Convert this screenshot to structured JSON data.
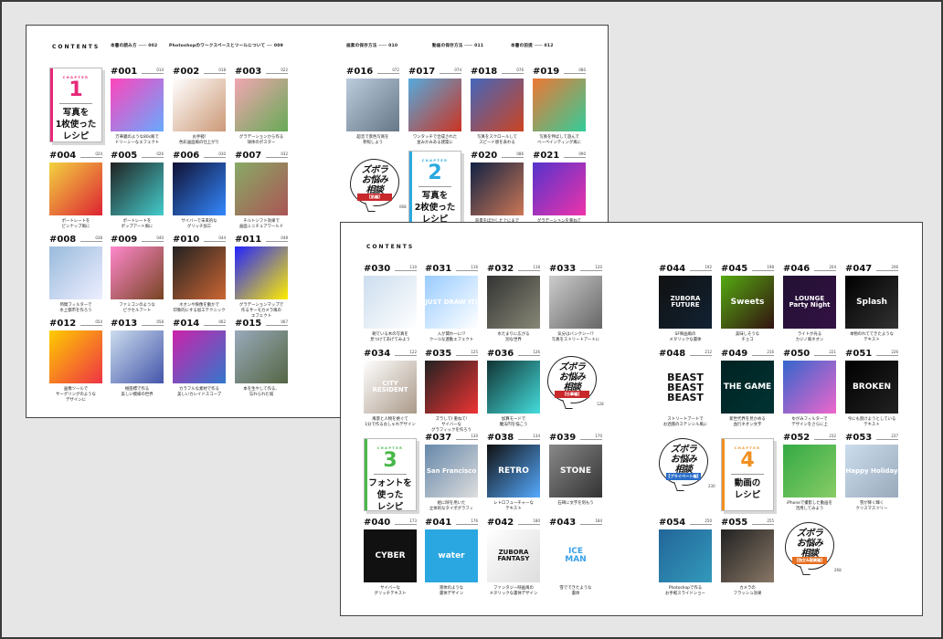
{
  "spread_a": {
    "contents_label": "CONTENTS",
    "headers": [
      {
        "text": "本書の読み方",
        "page": "002"
      },
      {
        "text": "Photoshopのワークスペースとツールについて",
        "page": "009"
      },
      {
        "text": "画素の保存方法",
        "page": "010"
      },
      {
        "text": "動画の保存方法",
        "page": "011"
      },
      {
        "text": "本書の前提",
        "page": "012"
      }
    ],
    "chapter1": {
      "label": "CHAPTER",
      "number": "1",
      "title": "写真を\n1枚使った\nレシピ"
    },
    "chapter2": {
      "label": "CHAPTER",
      "number": "2",
      "title": "写真を\n2枚使った\nレシピ"
    },
    "bubble": {
      "text": "ズボラ\nお悩み\n相談",
      "tag": "【肌編】",
      "page": "068"
    },
    "items": [
      {
        "num": "#001",
        "page": "014",
        "caption": "万華鏡のような80s風で\nドリーミーなエフェクト",
        "colors": [
          "#f4b",
          "#6af"
        ]
      },
      {
        "num": "#002",
        "page": "018",
        "caption": "お手軽!\n色彩画面風の仕上がり",
        "colors": [
          "#fff",
          "#c97"
        ]
      },
      {
        "num": "#003",
        "page": "022",
        "caption": "グラデーションから作る\n球体のポスター",
        "colors": [
          "#f2a6b2",
          "#6a5"
        ]
      },
      {
        "num": "#004",
        "page": "024",
        "caption": "ポートレートを\nピンナップ風に",
        "colors": [
          "#f3d33f",
          "#d23"
        ]
      },
      {
        "num": "#005",
        "page": "026",
        "caption": "ポートレートを\nポップアート風に",
        "colors": [
          "#222",
          "#4cc"
        ]
      },
      {
        "num": "#006",
        "page": "030",
        "caption": "サイバーで未来的な\nグリッチ加工",
        "colors": [
          "#113",
          "#38f"
        ]
      },
      {
        "num": "#007",
        "page": "032",
        "caption": "チルトシフト効果で\n画面ミニチュアワールド",
        "colors": [
          "#8a6",
          "#a55"
        ]
      },
      {
        "num": "#008",
        "page": "038",
        "caption": "時間フィルターで\n水上都市を作ろう",
        "colors": [
          "#9bd",
          "#eef"
        ]
      },
      {
        "num": "#009",
        "page": "040",
        "caption": "ファミコンのような\nピクセルアート",
        "colors": [
          "#f8c",
          "#742"
        ]
      },
      {
        "num": "#010",
        "page": "044",
        "caption": "ネオンや映像を動かで\n印象的にする加工テクニック",
        "colors": [
          "#222",
          "#c63"
        ]
      },
      {
        "num": "#011",
        "page": "048",
        "caption": "グラデーションマップで\n作るサーモカメラ風の\nエフェクト",
        "colors": [
          "#22f",
          "#fe0"
        ]
      },
      {
        "num": "#012",
        "page": "054",
        "caption": "画像ツールで\nサーグリングのような\nデザインに",
        "colors": [
          "#fc0",
          "#e34"
        ]
      },
      {
        "num": "#013",
        "page": "058",
        "caption": "極座標で作る\n美しい模様の世界",
        "colors": [
          "#cde",
          "#45a"
        ]
      },
      {
        "num": "#014",
        "page": "062",
        "caption": "カラフルな素材で作る\n美しいカレイドスコープ",
        "colors": [
          "#c2a",
          "#37c"
        ]
      },
      {
        "num": "#015",
        "page": "067",
        "caption": "本を生やして作る、\n忘れられた城",
        "colors": [
          "#9ab",
          "#564"
        ]
      },
      {
        "num": "#016",
        "page": "072",
        "caption": "超音で景色写真を\n参照しよう",
        "colors": [
          "#bcd",
          "#678"
        ]
      },
      {
        "num": "#017",
        "page": "074",
        "caption": "ワンタッチで合成された\n並みかみある建築に",
        "colors": [
          "#5ad",
          "#c32"
        ]
      },
      {
        "num": "#018",
        "page": "076",
        "caption": "写真をスクロールして\nスピード感を表わる",
        "colors": [
          "#46b",
          "#c42"
        ]
      },
      {
        "num": "#019",
        "page": "080",
        "caption": "写真を伸ばして遊んで\nベーペインティング風に",
        "colors": [
          "#e73",
          "#3c9"
        ]
      },
      {
        "num": "#020",
        "page": "086",
        "caption": "背景をぼかした上にまで\nスピード感溢れる描出に",
        "colors": [
          "#124",
          "#c75"
        ]
      },
      {
        "num": "#021",
        "page": "090",
        "caption": "グラデーションを重ねて\n作品に奥行きを出す",
        "colors": [
          "#53c",
          "#e3a"
        ]
      }
    ]
  },
  "spread_b": {
    "contents_label": "CONTENTS",
    "chapter3": {
      "label": "CHAPTER",
      "number": "3",
      "title": "フォントを\n使った\nレシピ"
    },
    "chapter4": {
      "label": "CHAPTER",
      "number": "4",
      "title": "動画の\nレシピ"
    },
    "bubbles": [
      {
        "text": "ズボラ\nお悩み\n相談",
        "tag": "【仕事編】",
        "page": "128"
      },
      {
        "text": "ズボラ\nお悩み\n相談",
        "tag": "【プライベート編】",
        "page": "230"
      },
      {
        "text": "ズボラ\nお悩み\n相談",
        "tag": "【独立&副業編】",
        "page": "268"
      }
    ],
    "items": [
      {
        "num": "#030",
        "page": "110",
        "caption": "朝ている木の写真を\n見つけてあげてみよう",
        "colors": [
          "#cde",
          "#fff"
        ],
        "text": ""
      },
      {
        "num": "#031",
        "page": "116",
        "caption": "入が関わ一に!?\nクールな連動エフェクト",
        "colors": [
          "#9cf",
          "#fff"
        ],
        "text": "JUST DRAW IT!"
      },
      {
        "num": "#032",
        "page": "118",
        "caption": "水たまりに広がる\n別な世界",
        "colors": [
          "#333",
          "#887"
        ],
        "text": ""
      },
      {
        "num": "#033",
        "page": "120",
        "caption": "気分はバンクシー!?\n写真をストリートアートに",
        "colors": [
          "#ccc",
          "#666"
        ],
        "text": ""
      },
      {
        "num": "#034",
        "page": "122",
        "caption": "風景と人物を絶ぐて\n1分で作るおしゃれデザイン",
        "colors": [
          "#fff",
          "#a98"
        ],
        "text": "CITY RESIDENT"
      },
      {
        "num": "#035",
        "page": "125",
        "caption": "ズラしてI 重ねて!\nサイバーな\nグラフィックを作ろう",
        "colors": [
          "#222",
          "#e33"
        ],
        "text": ""
      },
      {
        "num": "#036",
        "page": "126",
        "caption": "加算モードで\n魔法円を描こう",
        "colors": [
          "#133",
          "#4dd"
        ],
        "text": ""
      },
      {
        "num": "#037",
        "page": "130",
        "caption": "絵に映を用いた\n立体的なタイポグラフィ",
        "colors": [
          "#68a",
          "#ddd"
        ],
        "text": "San Francisco"
      },
      {
        "num": "#038",
        "page": "134",
        "caption": "レトロフューチャーな\nテキスト",
        "colors": [
          "#111",
          "#5af"
        ],
        "text": "RETRO"
      },
      {
        "num": "#039",
        "page": "170",
        "caption": "石碑に文字を刻もう",
        "colors": [
          "#888",
          "#333"
        ],
        "text": "STONE"
      },
      {
        "num": "#040",
        "page": "173",
        "caption": "サイバーな\nグリッチテキスト",
        "colors": [
          "#111",
          "#111"
        ],
        "text": "CYBER"
      },
      {
        "num": "#041",
        "page": "176",
        "caption": "液体のような\n書体デザイン",
        "colors": [
          "#2aa7e0",
          "#2aa7e0"
        ],
        "text": "water"
      },
      {
        "num": "#042",
        "page": "180",
        "caption": "ファンタジー映画風の\nメタリックな書体デザイン",
        "colors": [
          "#fff",
          "#ddd"
        ],
        "text": "ZUBORA\nFANTASY"
      },
      {
        "num": "#043",
        "page": "184",
        "caption": "雪でできたような\n書体",
        "colors": [
          "#fff",
          "#fff"
        ],
        "text": "ICE\nMAN"
      },
      {
        "num": "#044",
        "page": "192",
        "caption": "SF映画風の\nメタリックな書体",
        "colors": [
          "#111",
          "#123"
        ],
        "text": "ZUBORA\nFUTURE"
      },
      {
        "num": "#045",
        "page": "198",
        "caption": "美味しそうな\nチョコ",
        "colors": [
          "#5a1",
          "#311"
        ],
        "text": "Sweets"
      },
      {
        "num": "#046",
        "page": "204",
        "caption": "ライトが光る\nカジノ風ネオン",
        "colors": [
          "#213",
          "#314"
        ],
        "text": "LOUNGE\nParty Night"
      },
      {
        "num": "#047",
        "page": "206",
        "caption": "本物のれててきたような\nテキスト",
        "colors": [
          "#000",
          "#333"
        ],
        "text": "Splash"
      },
      {
        "num": "#048",
        "page": "212",
        "caption": "ストリートアートで\nお洒落のステンシル風に",
        "colors": [
          "#fff",
          "#fff"
        ],
        "text": "BEAST\nBEAST\nBEAST"
      },
      {
        "num": "#049",
        "page": "216",
        "caption": "新世代界を見かめる\n血行ネオン文字",
        "colors": [
          "#022",
          "#033"
        ],
        "text": "THE GAME"
      },
      {
        "num": "#050",
        "page": "221",
        "caption": "ゆがみフィルターで\nデザインをさらに上",
        "colors": [
          "#36c",
          "#e6c"
        ],
        "text": ""
      },
      {
        "num": "#051",
        "page": "226",
        "caption": "今にも割けようとしている\nテキスト",
        "colors": [
          "#000",
          "#222"
        ],
        "text": "BROKEN"
      },
      {
        "num": "#052",
        "page": "232",
        "caption": "iPhoneで撮影した動画を\n活用してみよう",
        "colors": [
          "#3a4",
          "#8c6"
        ],
        "text": ""
      },
      {
        "num": "#053",
        "page": "237",
        "caption": "雪が降く輝く\nクリスマスツリー",
        "colors": [
          "#cde",
          "#9ab"
        ],
        "text": "Happy Holiday"
      },
      {
        "num": "#054",
        "page": "250",
        "caption": "Photoshopで作る\nお手軽スライドショー",
        "colors": [
          "#269",
          "#39b"
        ],
        "text": ""
      },
      {
        "num": "#055",
        "page": "255",
        "caption": "カメラの\nフラッシュ効果",
        "colors": [
          "#222",
          "#876"
        ],
        "text": ""
      }
    ]
  },
  "accents": {
    "chapter1": "#e8287a",
    "chapter2": "#2aa9e0",
    "chapter3": "#49b84a",
    "chapter4": "#f09020",
    "bubble_tag1": "#c8282a",
    "bubble_tag2": "#2a6ec8",
    "bubble_tag3": "#e66e1f"
  }
}
